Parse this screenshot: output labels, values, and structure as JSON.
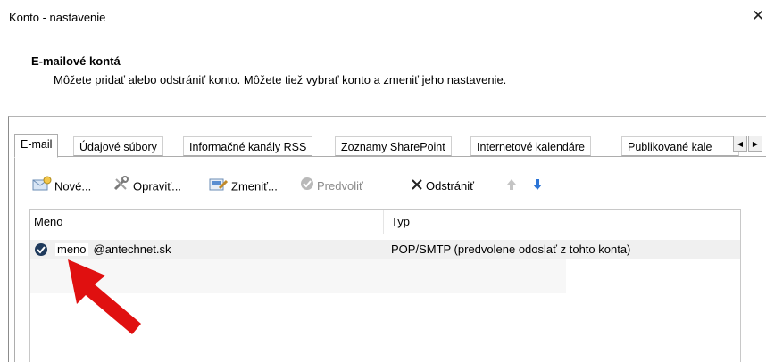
{
  "window": {
    "title": "Konto - nastavenie",
    "close_glyph": "✕"
  },
  "header": {
    "title": "E-mailové kontá",
    "description": "Môžete pridať alebo odstrániť konto. Môžete tiež vybrať konto a zmeniť jeho nastavenie."
  },
  "tabs": [
    {
      "label": "E-mail",
      "active": true
    },
    {
      "label": "Údajové súbory",
      "active": false
    },
    {
      "label": "Informačné kanály RSS",
      "active": false
    },
    {
      "label": "Zoznamy SharePoint",
      "active": false
    },
    {
      "label": "Internetové kalendáre",
      "active": false
    },
    {
      "label": "Publikované kale",
      "active": false
    }
  ],
  "tab_scroll": {
    "left": "◀",
    "right": "▶"
  },
  "toolbar": {
    "new": "Nové...",
    "repair": "Opraviť...",
    "change": "Zmeniť...",
    "default": "Predvoliť",
    "remove": "Odstrániť",
    "up_icon": "arrow-up-icon",
    "down_icon": "arrow-down-icon"
  },
  "table": {
    "columns": [
      "Meno",
      "Typ"
    ],
    "rows": [
      {
        "name_prefix": "meno",
        "name_domain": "@antechnet.sk",
        "type": "POP/SMTP (predvolene odoslať z tohto konta)",
        "default": true
      }
    ]
  },
  "colors": {
    "annotation_arrow": "#e01010",
    "toolbar_blue": "#2b74d6"
  }
}
